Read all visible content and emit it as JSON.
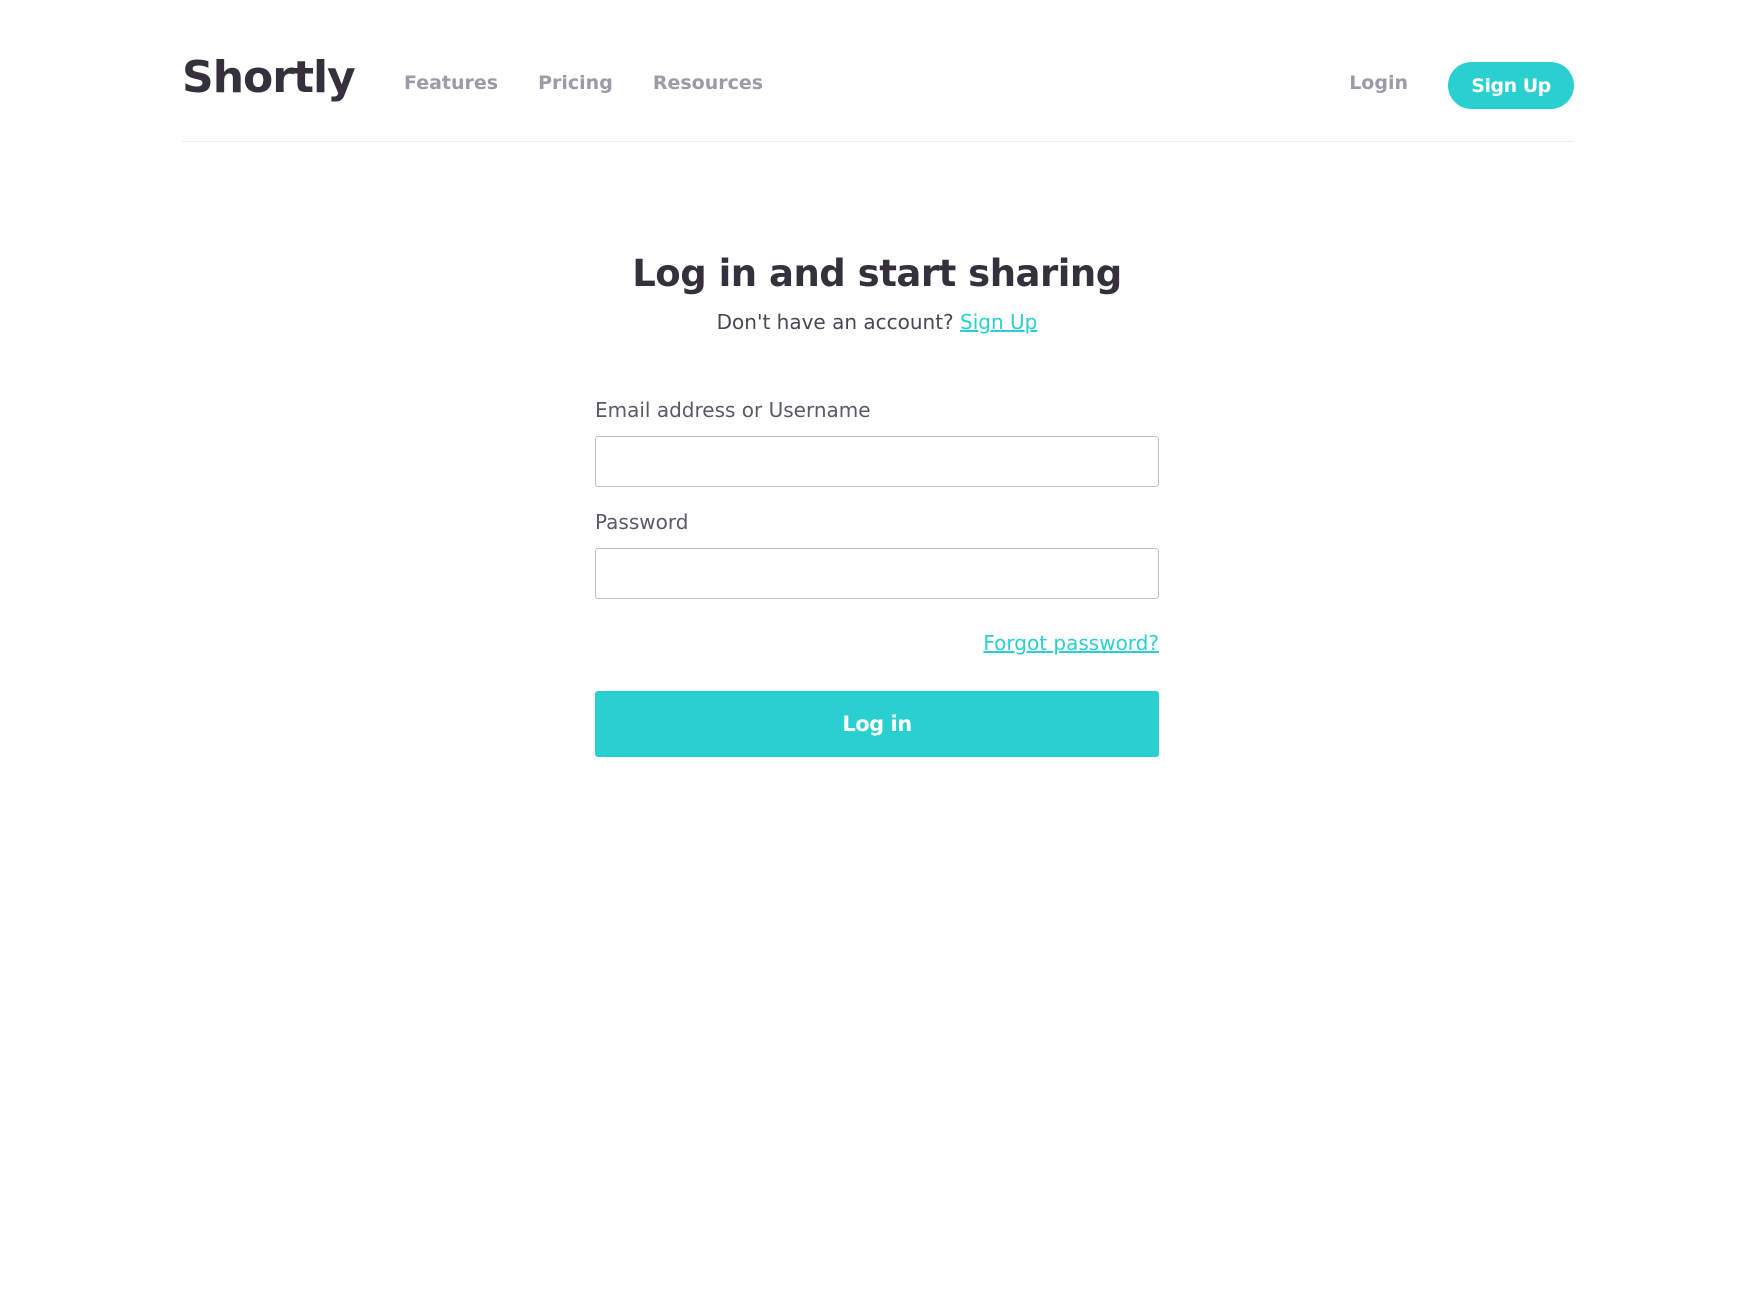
{
  "header": {
    "logo": "Shortly",
    "nav": [
      {
        "label": "Features"
      },
      {
        "label": "Pricing"
      },
      {
        "label": "Resources"
      }
    ],
    "login_label": "Login",
    "signup_label": "Sign Up"
  },
  "main": {
    "title": "Log in and start sharing",
    "subtitle_prefix": "Don't have an account?",
    "subtitle_link": "Sign Up",
    "email_label": "Email address or Username",
    "email_value": "",
    "password_label": "Password",
    "password_value": "",
    "forgot_label": "Forgot password?",
    "login_button": "Log in"
  },
  "colors": {
    "accent": "#2acfcf",
    "heading": "#34313d",
    "muted": "#9e9aa8"
  }
}
